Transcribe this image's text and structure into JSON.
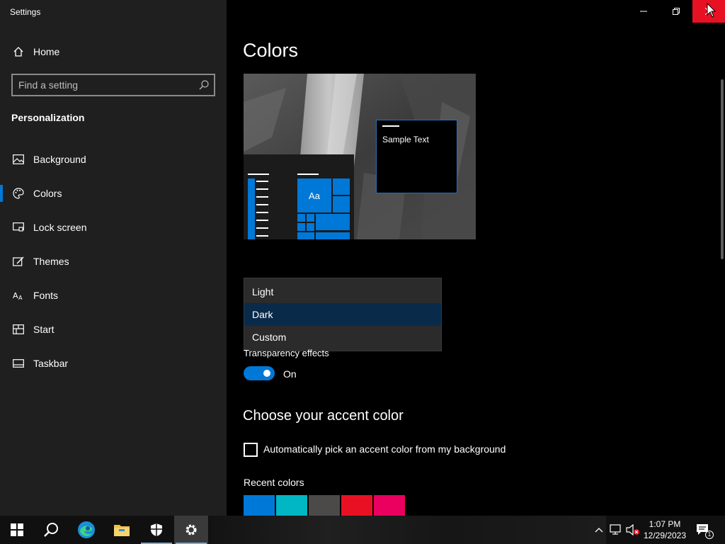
{
  "window": {
    "title": "Settings"
  },
  "sidebar": {
    "home_label": "Home",
    "search_placeholder": "Find a setting",
    "section_label": "Personalization",
    "items": [
      {
        "label": "Background",
        "icon": "image-icon"
      },
      {
        "label": "Colors",
        "icon": "palette-icon",
        "selected": true
      },
      {
        "label": "Lock screen",
        "icon": "lock-screen-icon"
      },
      {
        "label": "Themes",
        "icon": "themes-icon"
      },
      {
        "label": "Fonts",
        "icon": "fonts-icon"
      },
      {
        "label": "Start",
        "icon": "start-icon"
      },
      {
        "label": "Taskbar",
        "icon": "taskbar-icon"
      }
    ]
  },
  "main": {
    "page_title": "Colors",
    "preview": {
      "sample_text": "Sample Text",
      "tile_text": "Aa"
    },
    "mode_dropdown": {
      "options": [
        "Light",
        "Dark",
        "Custom"
      ],
      "selected": "Dark"
    },
    "transparency": {
      "label": "Transparency effects",
      "state_label": "On",
      "on": true
    },
    "accent": {
      "title": "Choose your accent color",
      "auto_pick_label": "Automatically pick an accent color from my background",
      "auto_pick_checked": false,
      "recent_label": "Recent colors",
      "recent_colors": [
        "#0078d7",
        "#00b7c3",
        "#4c4a48",
        "#e81123",
        "#ea005e"
      ]
    }
  },
  "colors": {
    "accent": "#0078d7",
    "close_hover": "#e81123",
    "sidebar_bg": "#1f1f1f"
  },
  "taskbar": {
    "apps": [
      {
        "name": "start-button",
        "icon": "windows-logo-icon"
      },
      {
        "name": "search-button",
        "icon": "search-icon"
      },
      {
        "name": "edge-button",
        "icon": "edge-icon"
      },
      {
        "name": "file-explorer-button",
        "icon": "folder-icon"
      },
      {
        "name": "security-button",
        "icon": "shield-icon"
      },
      {
        "name": "settings-button",
        "icon": "gear-icon",
        "active": true
      }
    ],
    "clock": {
      "time": "1:07 PM",
      "date": "12/29/2023"
    },
    "notification_count": "1"
  }
}
